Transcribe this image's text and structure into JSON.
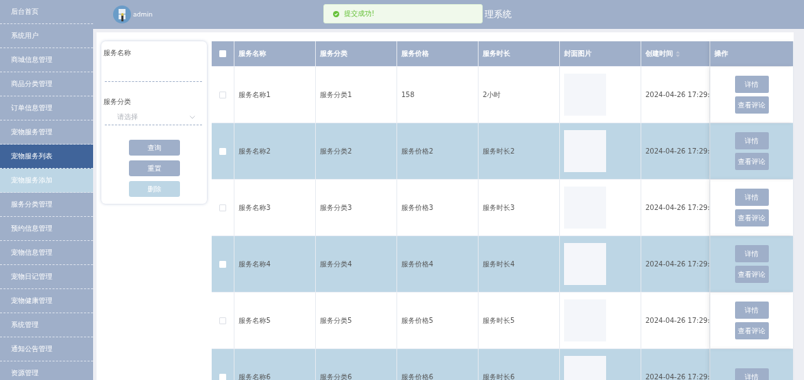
{
  "sidebar": {
    "items": [
      {
        "label": "后台首页",
        "selected": false
      },
      {
        "label": "系统用户",
        "selected": false
      },
      {
        "label": "商城信息管理",
        "selected": false
      },
      {
        "label": "商品分类管理",
        "selected": false
      },
      {
        "label": "订单信息管理",
        "selected": false
      },
      {
        "label": "宠物服务管理",
        "selected": false,
        "expanded": true,
        "children": [
          {
            "label": "宠物服务列表",
            "selected": true
          },
          {
            "label": "宠物服务添加",
            "selected": false
          }
        ]
      },
      {
        "label": "服务分类管理",
        "selected": false
      },
      {
        "label": "预约信息管理",
        "selected": false
      },
      {
        "label": "宠物信息管理",
        "selected": false
      },
      {
        "label": "宠物日记管理",
        "selected": false
      },
      {
        "label": "宠物健康管理",
        "selected": false
      },
      {
        "label": "系统管理",
        "selected": false
      },
      {
        "label": "通知公告管理",
        "selected": false
      },
      {
        "label": "资源管理",
        "selected": false
      }
    ]
  },
  "header": {
    "user": "admin",
    "title": "理系统"
  },
  "toast": {
    "message": "提交成功!"
  },
  "filter": {
    "fields": [
      {
        "label": "服务名称",
        "kind": "input"
      },
      {
        "label": "服务分类",
        "kind": "select",
        "placeholder": "请选择"
      }
    ],
    "buttons": [
      {
        "label": "查询",
        "disabled": false
      },
      {
        "label": "重置",
        "disabled": false
      },
      {
        "label": "删除",
        "disabled": true
      }
    ]
  },
  "table": {
    "all_checked": false,
    "columns": [
      "服务名称",
      "服务分类",
      "服务价格",
      "服务时长",
      "封面图片",
      "创建时间",
      "操作"
    ],
    "rows": [
      {
        "checked": false,
        "name": "服务名称1",
        "category": "服务分类1",
        "price": "158",
        "duration": "2小时",
        "created": "2024-04-26 17:29:",
        "actions": [
          "详情",
          "查看评论"
        ]
      },
      {
        "checked": false,
        "name": "服务名称2",
        "category": "服务分类2",
        "price": "服务价格2",
        "duration": "服务时长2",
        "created": "2024-04-26 17:29:",
        "actions": [
          "详情",
          "查看评论"
        ]
      },
      {
        "checked": false,
        "name": "服务名称3",
        "category": "服务分类3",
        "price": "服务价格3",
        "duration": "服务时长3",
        "created": "2024-04-26 17:29:",
        "actions": [
          "详情",
          "查看评论"
        ]
      },
      {
        "checked": false,
        "name": "服务名称4",
        "category": "服务分类4",
        "price": "服务价格4",
        "duration": "服务时长4",
        "created": "2024-04-26 17:29:",
        "actions": [
          "详情",
          "查看评论"
        ]
      },
      {
        "checked": false,
        "name": "服务名称5",
        "category": "服务分类5",
        "price": "服务价格5",
        "duration": "服务时长5",
        "created": "2024-04-26 17:29:",
        "actions": [
          "详情",
          "查看评论"
        ]
      },
      {
        "checked": false,
        "name": "服务名称6",
        "category": "服务分类6",
        "price": "服务价格6",
        "duration": "服务时长6",
        "created": "2024-04-26 17:29:",
        "actions": [
          "详情"
        ]
      }
    ]
  }
}
